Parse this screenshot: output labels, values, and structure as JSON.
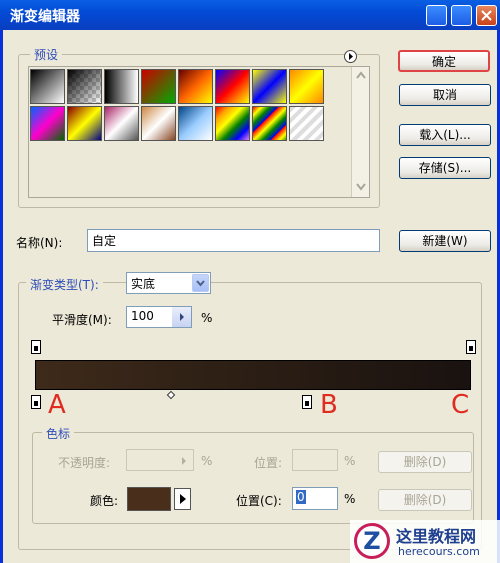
{
  "window": {
    "title": "渐变编辑器"
  },
  "presets": {
    "legend": "预设"
  },
  "buttons": {
    "ok": "确定",
    "cancel": "取消",
    "load": "载入(L)...",
    "save": "存储(S)...",
    "new": "新建(W)"
  },
  "name": {
    "label": "名称(N):",
    "value": "自定"
  },
  "gradient": {
    "type_label": "渐变类型(T):",
    "type_value": "实底",
    "smoothness_label": "平滑度(M):",
    "smoothness_value": "100",
    "percent": "%",
    "colors": {
      "start": "#3E2A1A",
      "mid": "#2B1E14",
      "end": "#1A1210"
    }
  },
  "stops_group": {
    "legend": "色标",
    "opacity_label": "不透明度:",
    "opacity_percent": "%",
    "opacity_position_label": "位置:",
    "opacity_position_percent": "%",
    "opacity_delete": "删除(D)",
    "color_label": "颜色:",
    "color_swatch": "#4A2E1C",
    "color_position_label": "位置(C):",
    "color_position_value": "0",
    "color_position_percent": "%",
    "color_delete": "删除(D)"
  },
  "annotations": {
    "a": "A",
    "b": "B",
    "c": "C"
  },
  "watermark": {
    "site": "这里教程网",
    "url": "herecours.com",
    "logo": "Z"
  }
}
